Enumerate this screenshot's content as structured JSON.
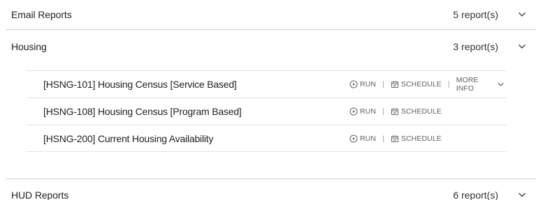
{
  "sections": [
    {
      "title": "Email Reports",
      "count": "5 report(s)"
    },
    {
      "title": "Housing",
      "count": "3 report(s)"
    },
    {
      "title": "HUD Reports",
      "count": "6 report(s)"
    }
  ],
  "housing_reports": [
    {
      "name": "[HSNG-101] Housing Census [Service Based]"
    },
    {
      "name": "[HSNG-108] Housing Census [Program Based]"
    },
    {
      "name": "[HSNG-200] Current Housing Availability"
    }
  ],
  "actions": {
    "run_label": "RUN",
    "schedule_label": "SCHEDULE",
    "more_info_label": "MORE INFO",
    "separator": "|"
  },
  "icons": {
    "chevron": "chevron-down-icon",
    "run": "play-circle-icon",
    "schedule": "calendar-check-icon"
  },
  "colors": {
    "divider": "#cfcfcf",
    "row_border": "#e3e3e3",
    "action_text": "#616161"
  }
}
